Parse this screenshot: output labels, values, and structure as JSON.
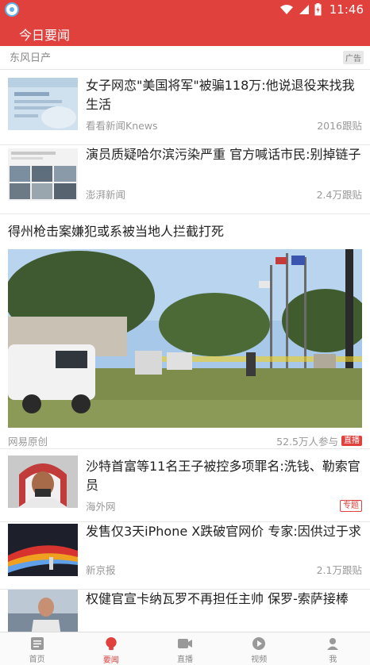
{
  "status_bar": {
    "time": "11:46"
  },
  "header": {
    "title": "今日要闻"
  },
  "feed": {
    "ad": {
      "source": "东风日产",
      "tag": "广告"
    },
    "items": [
      {
        "title": "女子网恋\"美国将军\"被骗118万:他说退役来找我生活",
        "source": "看看新闻Knews",
        "meta": "2016跟贴",
        "thumb_icon": "phone-screenshot-thumbnail"
      },
      {
        "title": "演员质疑哈尔滨污染严重 官方喊话市民:别掉链子",
        "source": "澎湃新闻",
        "meta": "2.4万跟贴",
        "thumb_icon": "city-photos-thumbnail"
      },
      {
        "title": "得州枪击案嫌犯或系被当地人拦截打死",
        "source": "网易原创",
        "meta": "52.5万人参与",
        "badge": "直播",
        "photo_icon": "crime-scene-photo"
      },
      {
        "title": "沙特首富等11名王子被控多项罪名:洗钱、勒索官员",
        "source": "海外网",
        "badge": "专题",
        "thumb_icon": "saudi-prince-portrait"
      },
      {
        "title": "发售仅3天iPhone X跌破官网价 专家:因供过于求",
        "source": "新京报",
        "meta": "2.1万跟贴",
        "thumb_icon": "iphone-launch-thumbnail"
      },
      {
        "title": "权健官宣卡纳瓦罗不再担任主帅 保罗-索萨接棒",
        "thumb_icon": "coach-photo-thumbnail"
      }
    ]
  },
  "bottom_nav": {
    "items": [
      {
        "label": "首页",
        "icon": "home-news-icon"
      },
      {
        "label": "要闻",
        "icon": "bulb-icon",
        "active": true
      },
      {
        "label": "直播",
        "icon": "video-camera-icon"
      },
      {
        "label": "视频",
        "icon": "play-icon"
      },
      {
        "label": "我",
        "icon": "person-icon"
      }
    ]
  },
  "colors": {
    "brand": "#e0413d",
    "text": "#222222",
    "muted": "#999999"
  }
}
